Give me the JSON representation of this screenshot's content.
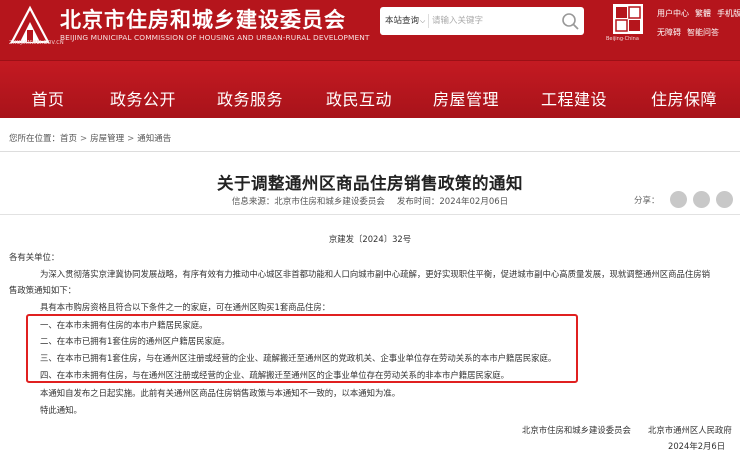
{
  "header": {
    "logo_sub": "ZHUJIANWEI.GOV.CN",
    "title": "北京市住房和城乡建设委员会",
    "title_en": "BEIJING MUNICIPAL COMMISSION OF HOUSING AND URBAN-RURAL DEVELOPMENT",
    "search": {
      "scope_label": "本站查询",
      "placeholder": "请输入关键字"
    },
    "seal_text": "Beijing·China",
    "links_row1": [
      "用户中心",
      "繁體",
      "手机版"
    ],
    "links_row2": [
      "无障碍",
      "智能问答"
    ]
  },
  "nav": {
    "items": [
      "首页",
      "政务公开",
      "政务服务",
      "政民互动",
      "房屋管理",
      "工程建设",
      "住房保障"
    ]
  },
  "breadcrumb": {
    "prefix": "您所在位置：",
    "items": [
      "首页",
      "房屋管理",
      "通知通告"
    ],
    "separator": ">"
  },
  "article": {
    "title": "关于调整通州区商品住房销售政策的通知",
    "source_label": "信息来源：北京市住房和城乡建设委员会",
    "date_label": "发布时间：2024年02月06日",
    "share_label": "分享："
  },
  "body": {
    "doc_number": "京建发〔2024〕32号",
    "salutation": "各有关单位：",
    "intro_line1": "为深入贯彻落实京津冀协同发展战略，有序有效有力推动中心城区非首都功能和人口向城市副中心疏解，更好实现职住平衡，促进城市副中心高质量发展，现就调整通州区商品住房销",
    "intro_line2": "售政策通知如下：",
    "condition_intro": "具有本市购房资格且符合以下条件之一的家庭，可在通州区购买1套商品住房：",
    "conditions": [
      "一、在本市未拥有住房的本市户籍居民家庭。",
      "二、在本市已拥有1套住房的通州区户籍居民家庭。",
      "三、在本市已拥有1套住房，与在通州区注册或经营的企业、疏解搬迁至通州区的党政机关、企事业单位存在劳动关系的本市户籍居民家庭。",
      "四、在本市未拥有住房，与在通州区注册或经营的企业、疏解搬迁至通州区的企事业单位存在劳动关系的非本市户籍居民家庭。"
    ],
    "effective": "本通知自发布之日起实施。此前有关通州区商品住房销售政策与本通知不一致的，以本通知为准。",
    "closing": "特此通知。",
    "signers": [
      "北京市住房和城乡建设委员会",
      "北京市通州区人民政府"
    ],
    "date": "2024年2月6日"
  },
  "colors": {
    "brand_red": "#b5151c",
    "highlight_border": "#e02020"
  },
  "icons": [
    "search-icon",
    "wechat-icon",
    "weibo-icon",
    "more-share-icon"
  ]
}
